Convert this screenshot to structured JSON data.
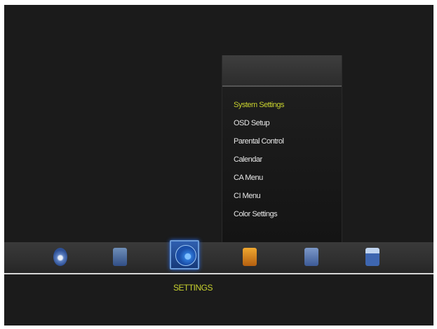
{
  "menu": {
    "items": [
      {
        "label": "System Settings"
      },
      {
        "label": "OSD Setup"
      },
      {
        "label": "Parental Control"
      },
      {
        "label": "Calendar"
      },
      {
        "label": "CA Menu"
      },
      {
        "label": "CI Menu"
      },
      {
        "label": "Color Settings"
      }
    ],
    "selected_label": "System Settings"
  },
  "dock": {
    "items": [
      {
        "icon": "satellite-icon"
      },
      {
        "icon": "tv-icon"
      },
      {
        "icon": "settings-icon",
        "selected": true
      },
      {
        "icon": "folder-icon"
      },
      {
        "icon": "globe-icon"
      },
      {
        "icon": "monitor-icon"
      }
    ],
    "selected_caption": "SETTINGS"
  },
  "colors": {
    "highlight": "#c8d22e",
    "background": "#1b1b1b",
    "selected_tile": "#2f5fb0"
  }
}
